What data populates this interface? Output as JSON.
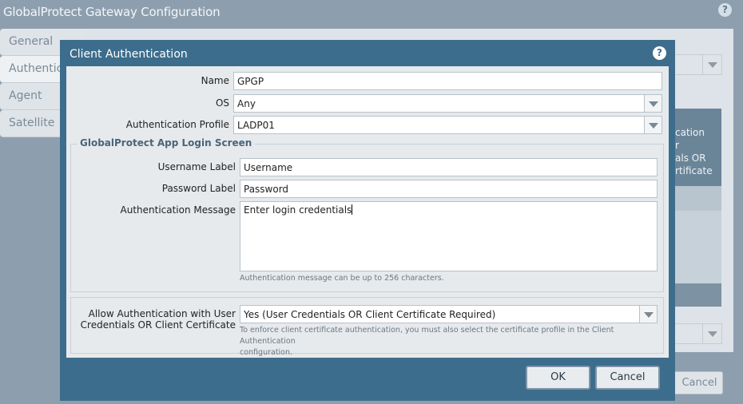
{
  "outer": {
    "title": "GlobalProtect Gateway Configuration",
    "help_icon": "?",
    "tabs": [
      {
        "label": "General"
      },
      {
        "label": "Authenticat"
      },
      {
        "label": "Agent"
      },
      {
        "label": "Satellite"
      }
    ],
    "grid_header_lines": [
      "cation",
      "r",
      "als OR",
      "rtificate"
    ],
    "cancel_label": "Cancel"
  },
  "dialog": {
    "title": "Client Authentication",
    "help_icon": "?",
    "name": {
      "label": "Name",
      "value": "GPGP"
    },
    "os": {
      "label": "OS",
      "value": "Any"
    },
    "auth_profile": {
      "label": "Authentication Profile",
      "value": "LADP01"
    },
    "login_screen": {
      "legend": "GlobalProtect App Login Screen",
      "username_label": {
        "label": "Username Label",
        "value": "Username"
      },
      "password_label": {
        "label": "Password Label",
        "value": "Password"
      },
      "auth_message": {
        "label": "Authentication Message",
        "value": "Enter login credentials"
      },
      "auth_message_hint": "Authentication message can be up to 256 characters."
    },
    "allow_auth": {
      "label_line1": "Allow Authentication with User",
      "label_line2": "Credentials OR Client Certificate",
      "value": "Yes (User Credentials OR Client Certificate Required)",
      "hint_line1": "To enforce client certificate authentication, you must also select the certificate profile in the Client Authentication",
      "hint_line2": "configuration."
    },
    "ok_label": "OK",
    "cancel_label": "Cancel"
  }
}
